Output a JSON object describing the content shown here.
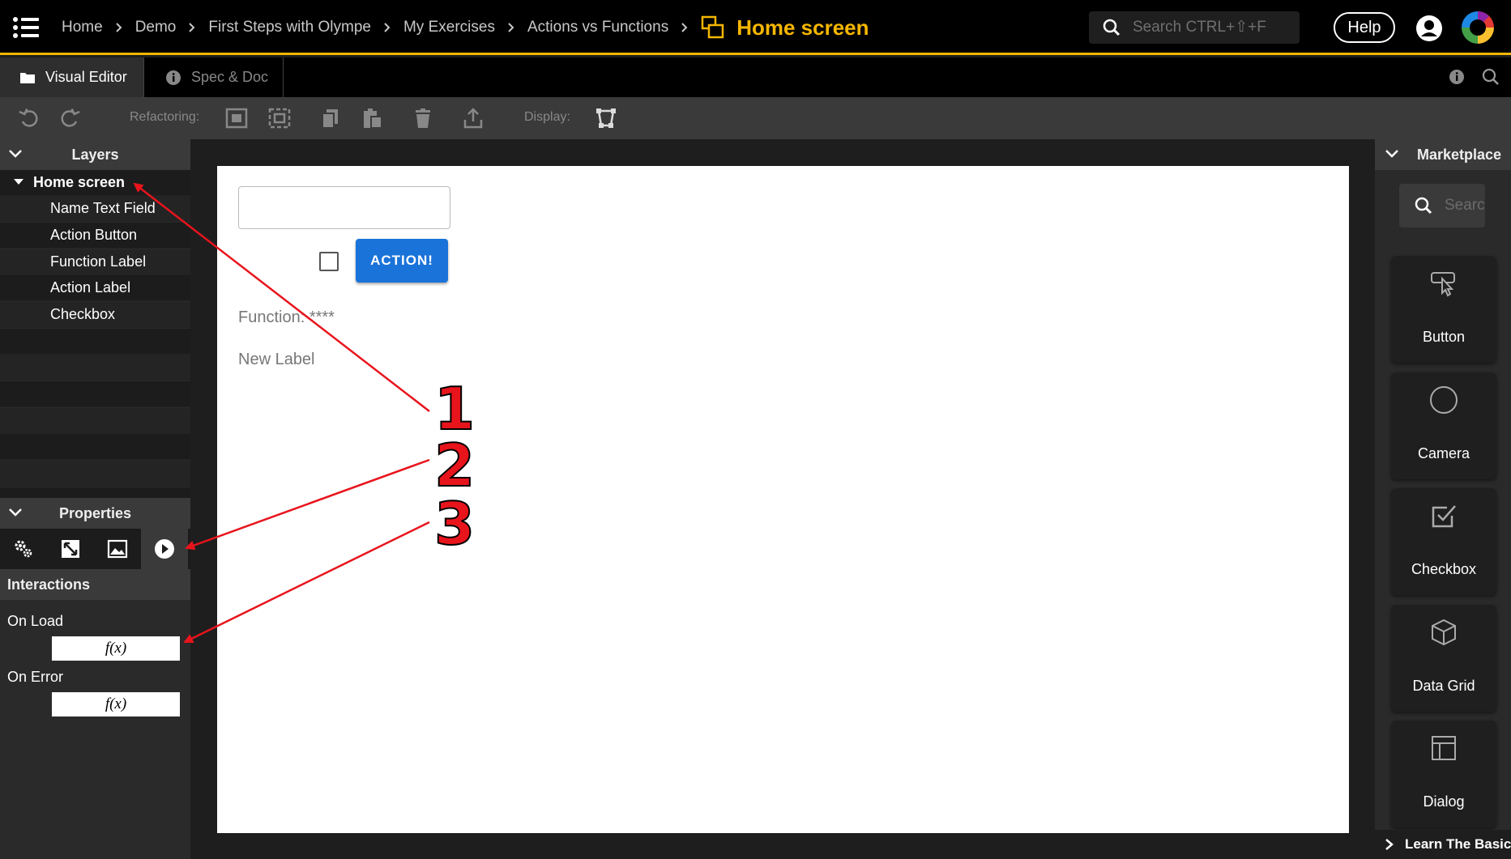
{
  "header": {
    "breadcrumb": [
      "Home",
      "Demo",
      "First Steps with Olympe",
      "My Exercises",
      "Actions vs Functions"
    ],
    "current_page": "Home screen",
    "search_placeholder": "Search CTRL+⇧+F",
    "help_label": "Help",
    "accent_color": "#f5b600"
  },
  "tabs": [
    {
      "label": "Visual Editor",
      "icon": "folder-icon",
      "active": true
    },
    {
      "label": "Spec & Doc",
      "icon": "info-icon",
      "active": false
    }
  ],
  "toolbar": {
    "refactoring_label": "Refactoring:",
    "display_label": "Display:"
  },
  "layers": {
    "title": "Layers",
    "root": "Home screen",
    "items": [
      "Name Text Field",
      "Action Button",
      "Function Label",
      "Action Label",
      "Checkbox"
    ]
  },
  "properties": {
    "title": "Properties",
    "section": "Interactions",
    "fields": [
      {
        "label": "On Load",
        "value": "f(x)"
      },
      {
        "label": "On Error",
        "value": "f(x)"
      }
    ]
  },
  "canvas": {
    "action_button": "ACTION!",
    "function_label": "Function: ****",
    "new_label": "New Label",
    "name_field_value": ""
  },
  "marketplace": {
    "title": "Marketplace",
    "search_placeholder": "Search",
    "items": [
      {
        "label": "Button",
        "icon": "cursor-click-icon"
      },
      {
        "label": "Camera",
        "icon": "circle-icon"
      },
      {
        "label": "Checkbox",
        "icon": "checkbox-icon"
      },
      {
        "label": "Data Grid",
        "icon": "cube-icon"
      },
      {
        "label": "Dialog",
        "icon": "dialog-icon"
      }
    ],
    "footer": "Learn The Basics"
  },
  "annotations": [
    "1",
    "2",
    "3"
  ],
  "annotation_color": "#e8141c"
}
